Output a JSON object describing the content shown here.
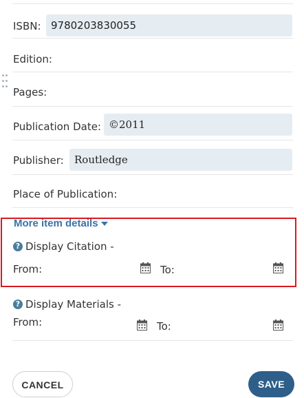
{
  "form": {
    "isbn": {
      "label": "ISBN:",
      "value": "9780203830055"
    },
    "edition": {
      "label": "Edition:"
    },
    "pages": {
      "label": "Pages:"
    },
    "publication_date": {
      "label": "Publication Date:",
      "value": "©2011"
    },
    "publisher": {
      "label": "Publisher:",
      "value": "Routledge"
    },
    "place_of_publication": {
      "label": "Place of Publication:"
    }
  },
  "more_details": {
    "label": "More item details"
  },
  "display_citation": {
    "label": "Display Citation -",
    "from": "From:",
    "to": "To:"
  },
  "display_materials": {
    "label": "Display Materials -",
    "from": "From:",
    "to": "To:"
  },
  "icons": {
    "help": "?",
    "calendar": "calendar-icon",
    "drag": "drag-handle-icon"
  },
  "buttons": {
    "cancel": "CANCEL",
    "save": "SAVE"
  },
  "colors": {
    "field_bg": "#e6edf2",
    "link": "#3973a8",
    "highlight_border": "#d8191f",
    "save_bg": "#2e5f8a"
  }
}
